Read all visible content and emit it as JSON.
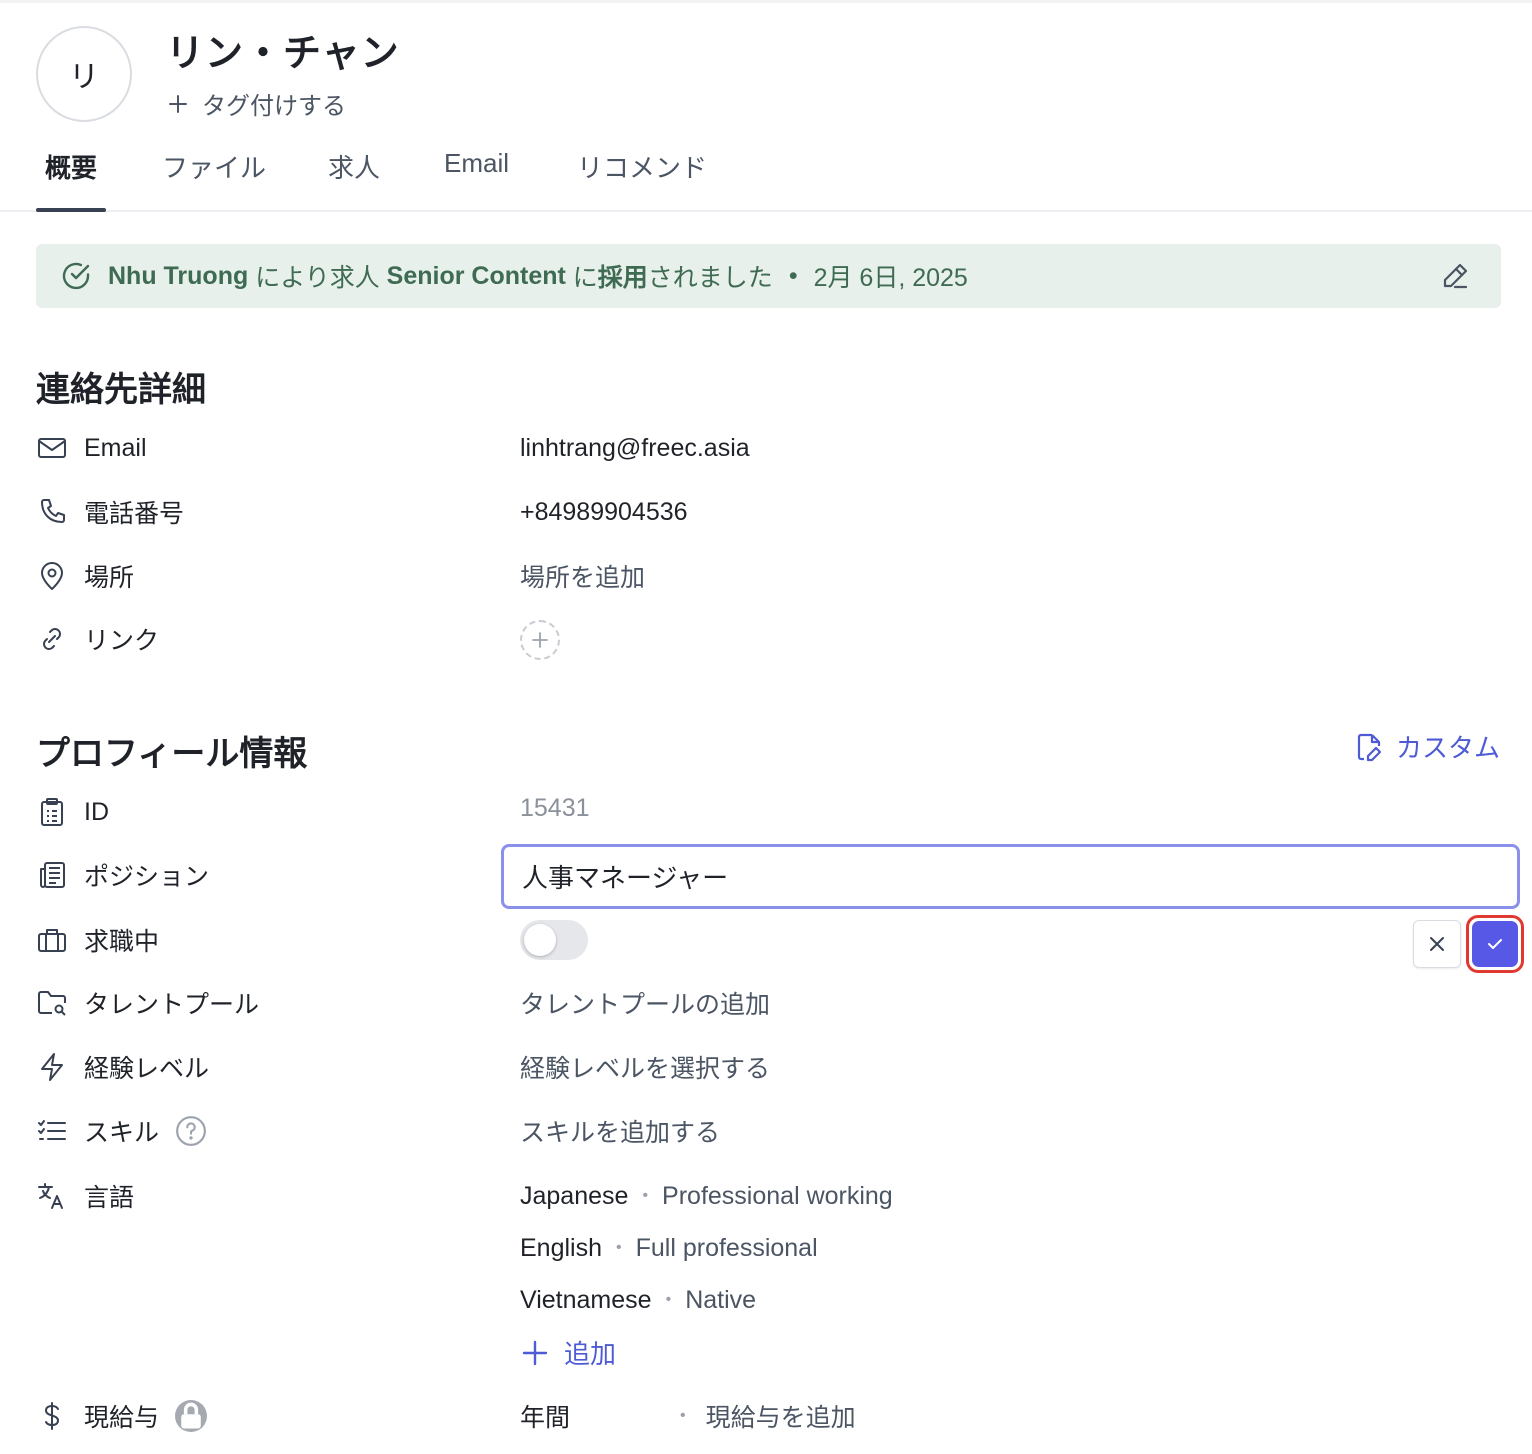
{
  "header": {
    "avatar_initial": "リ",
    "name": "リン・チャン",
    "tag_add_label": "タグ付けする"
  },
  "tabs": [
    {
      "label": "概要",
      "active": true
    },
    {
      "label": "ファイル",
      "active": false
    },
    {
      "label": "求人",
      "active": false
    },
    {
      "label": "Email",
      "active": false
    },
    {
      "label": "リコメンド",
      "active": false
    }
  ],
  "banner": {
    "actor": "Nhu Truong",
    "text1": " により求人 ",
    "job": "Senior Content",
    "text2": " に",
    "status": "採用",
    "text3": "されました",
    "bullet": "•",
    "date": "2月 6日, 2025"
  },
  "contact": {
    "title": "連絡先詳細",
    "email_label": "Email",
    "email_value": "linhtrang@freec.asia",
    "phone_label": "電話番号",
    "phone_value": "+84989904536",
    "location_label": "場所",
    "location_placeholder": "場所を追加",
    "link_label": "リンク"
  },
  "profile": {
    "title": "プロフィール情報",
    "custom_label": "カスタム",
    "id_label": "ID",
    "id_value": "15431",
    "position_label": "ポジション",
    "position_value": "人事マネージャー",
    "job_seeking_label": "求職中",
    "job_seeking_on": false,
    "talent_pool_label": "タレントプール",
    "talent_pool_placeholder": "タレントプールの追加",
    "experience_label": "経験レベル",
    "experience_placeholder": "経験レベルを選択する",
    "skills_label": "スキル",
    "skills_placeholder": "スキルを追加する",
    "language_label": "言語",
    "languages": [
      {
        "name": "Japanese",
        "level": "Professional working"
      },
      {
        "name": "English",
        "level": "Full professional"
      },
      {
        "name": "Vietnamese",
        "level": "Native"
      }
    ],
    "add_language_label": "追加",
    "salary_label": "現給与",
    "salary_period": "年間",
    "salary_placeholder": "現給与を追加"
  },
  "colors": {
    "accent": "#5858e6",
    "banner_bg": "#e7f0ea",
    "banner_text": "#3f6b53",
    "focus_border": "#8b90ea",
    "highlight_ring": "#e0392f"
  }
}
